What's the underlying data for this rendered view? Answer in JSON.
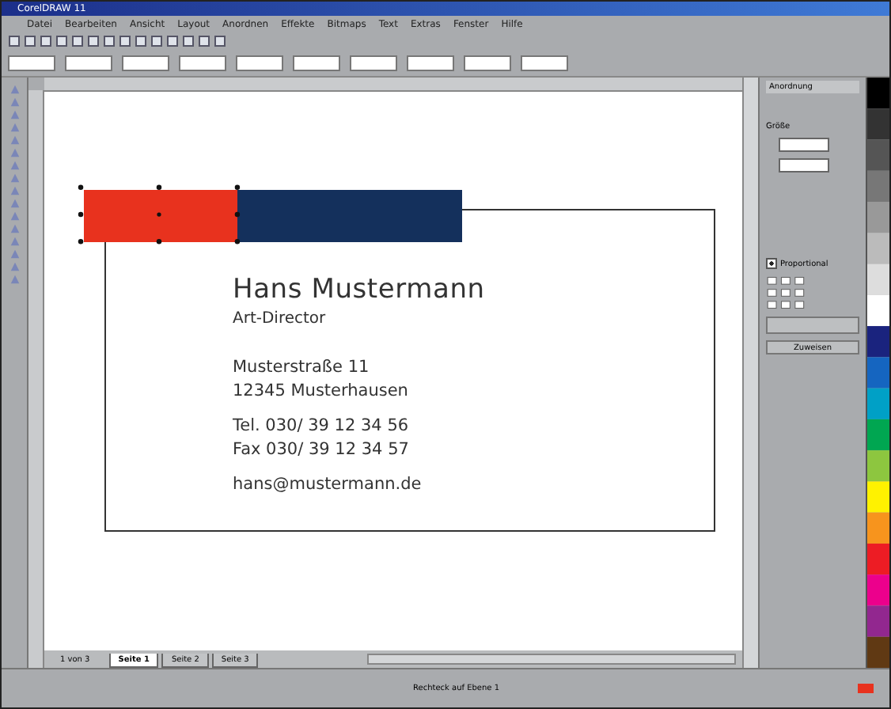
{
  "window": {
    "title": "CorelDRAW 11"
  },
  "menu": [
    {
      "label": "Datei"
    },
    {
      "label": "Bearbeiten"
    },
    {
      "label": "Ansicht"
    },
    {
      "label": "Layout"
    },
    {
      "label": "Anordnen"
    },
    {
      "label": "Effekte"
    },
    {
      "label": "Bitmaps"
    },
    {
      "label": "Text"
    },
    {
      "label": "Extras"
    },
    {
      "label": "Fenster"
    },
    {
      "label": "Hilfe"
    }
  ],
  "card": {
    "name": "Hans Mustermann",
    "role": "Art-Director",
    "street": "Musterstraße 11",
    "city": "12345 Musterhausen",
    "phone": "Tel.  030/ 39 12 34 56",
    "fax": "Fax  030/ 39 12 34 57",
    "email": "hans@mustermann.de"
  },
  "docker": {
    "title": "Anordnung",
    "section": "Größe",
    "proportional": {
      "label": "Proportional",
      "checked": true
    },
    "apply_button": "Zuweisen"
  },
  "page_tabs": [
    {
      "label": "Seite 1",
      "selected": true
    },
    {
      "label": "Seite 2",
      "selected": false
    },
    {
      "label": "Seite 3",
      "selected": false
    }
  ],
  "page_counter": "1 von 3",
  "status_bar": {
    "object": "Rechteck auf Ebene 1"
  }
}
